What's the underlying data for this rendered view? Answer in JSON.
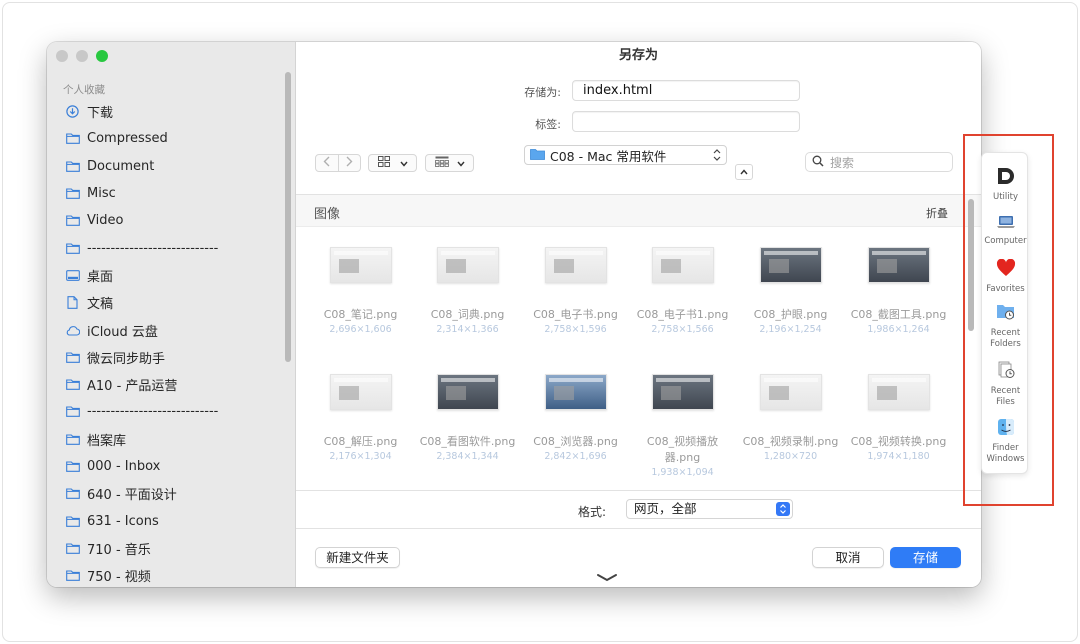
{
  "window": {
    "title": "另存为"
  },
  "sidebar": {
    "heading": "个人收藏",
    "items": [
      {
        "label": "下载",
        "icon": "download-circle-icon"
      },
      {
        "label": "Compressed",
        "icon": "folder-icon"
      },
      {
        "label": "Document",
        "icon": "folder-icon"
      },
      {
        "label": "Misc",
        "icon": "folder-icon"
      },
      {
        "label": "Video",
        "icon": "folder-icon"
      },
      {
        "label": "----------------------------",
        "icon": "folder-icon"
      },
      {
        "label": "桌面",
        "icon": "desktop-icon"
      },
      {
        "label": "文稿",
        "icon": "document-icon"
      },
      {
        "label": "iCloud 云盘",
        "icon": "cloud-icon"
      },
      {
        "label": "微云同步助手",
        "icon": "folder-icon"
      },
      {
        "label": "A10 - 产品运营",
        "icon": "folder-icon"
      },
      {
        "label": "----------------------------",
        "icon": "folder-icon"
      },
      {
        "label": "档案库",
        "icon": "folder-icon"
      },
      {
        "label": "000 - Inbox",
        "icon": "folder-icon"
      },
      {
        "label": "640 - 平面设计",
        "icon": "folder-icon"
      },
      {
        "label": "631 - Icons",
        "icon": "folder-icon"
      },
      {
        "label": "710 - 音乐",
        "icon": "folder-icon"
      },
      {
        "label": "750 - 视频",
        "icon": "folder-icon"
      }
    ]
  },
  "form": {
    "save_as_label": "存储为:",
    "save_as_value": "index.html",
    "tags_label": "标签:",
    "tags_value": ""
  },
  "toolbar": {
    "back_icon": "chevron-left-icon",
    "forward_icon": "chevron-right-icon",
    "view_icon": "icon-grid-icon",
    "group_icon": "group-grid-icon",
    "location": "C08 - Mac 常用软件",
    "search_placeholder": "搜索"
  },
  "browser": {
    "group_title": "图像",
    "collapse_label": "折叠",
    "files": [
      {
        "name": "C08_笔记.png",
        "dims": "2,696×1,606",
        "thumb": "light"
      },
      {
        "name": "C08_词典.png",
        "dims": "2,314×1,366",
        "thumb": "light"
      },
      {
        "name": "C08_电子书.png",
        "dims": "2,758×1,596",
        "thumb": "light"
      },
      {
        "name": "C08_电子书1.png",
        "dims": "2,758×1,566",
        "thumb": "light"
      },
      {
        "name": "C08_护眼.png",
        "dims": "2,196×1,254",
        "thumb": "dark"
      },
      {
        "name": "C08_截图工具.png",
        "dims": "1,986×1,264",
        "thumb": "dark"
      },
      {
        "name": "C08_解压.png",
        "dims": "2,176×1,304",
        "thumb": "light"
      },
      {
        "name": "C08_看图软件.png",
        "dims": "2,384×1,344",
        "thumb": "dark"
      },
      {
        "name": "C08_浏览器.png",
        "dims": "2,842×1,696",
        "thumb": "bluish"
      },
      {
        "name": "C08_视频播放器.png",
        "dims": "1,938×1,094",
        "thumb": "dark"
      },
      {
        "name": "C08_视频录制.png",
        "dims": "1,280×720",
        "thumb": "light"
      },
      {
        "name": "C08_视频转换.png",
        "dims": "1,974×1,180",
        "thumb": "light"
      }
    ]
  },
  "format": {
    "label": "格式:",
    "value": "网页，全部"
  },
  "buttons": {
    "new_folder": "新建文件夹",
    "cancel": "取消",
    "save": "存储"
  },
  "panel": {
    "items": [
      {
        "label": "Utility",
        "icon": "utility-d-icon"
      },
      {
        "label": "Computer",
        "icon": "computer-icon"
      },
      {
        "label": "Favorites",
        "icon": "heart-icon"
      },
      {
        "label": "Recent Folders",
        "icon": "recent-folder-icon"
      },
      {
        "label": "Recent Files",
        "icon": "recent-files-icon"
      },
      {
        "label": "Finder Windows",
        "icon": "finder-icon"
      }
    ]
  },
  "colors": {
    "accent": "#2f7cf6",
    "highlight_outline": "#e0432f",
    "traffic_green": "#28c840"
  }
}
